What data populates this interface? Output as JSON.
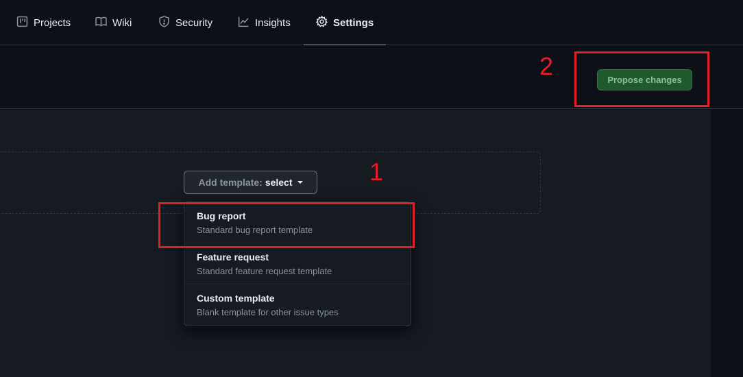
{
  "nav": {
    "tabs": [
      {
        "label": "Projects",
        "icon": "project-board-icon"
      },
      {
        "label": "Wiki",
        "icon": "book-icon"
      },
      {
        "label": "Security",
        "icon": "shield-icon"
      },
      {
        "label": "Insights",
        "icon": "graph-icon"
      },
      {
        "label": "Settings",
        "icon": "gear-icon",
        "active": true
      }
    ]
  },
  "header": {
    "propose_label": "Propose changes"
  },
  "editor": {
    "template_button_prefix": "Add template:",
    "template_button_value": "select"
  },
  "dropdown": {
    "items": [
      {
        "title": "Bug report",
        "description": "Standard bug report template"
      },
      {
        "title": "Feature request",
        "description": "Standard feature request template"
      },
      {
        "title": "Custom template",
        "description": "Blank template for other issue types"
      }
    ]
  },
  "annotations": {
    "one": "1",
    "two": "2"
  },
  "colors": {
    "accent_underline": "#f78166",
    "propose_bg": "#1e5a2d",
    "annotation_red": "#e41e26"
  }
}
